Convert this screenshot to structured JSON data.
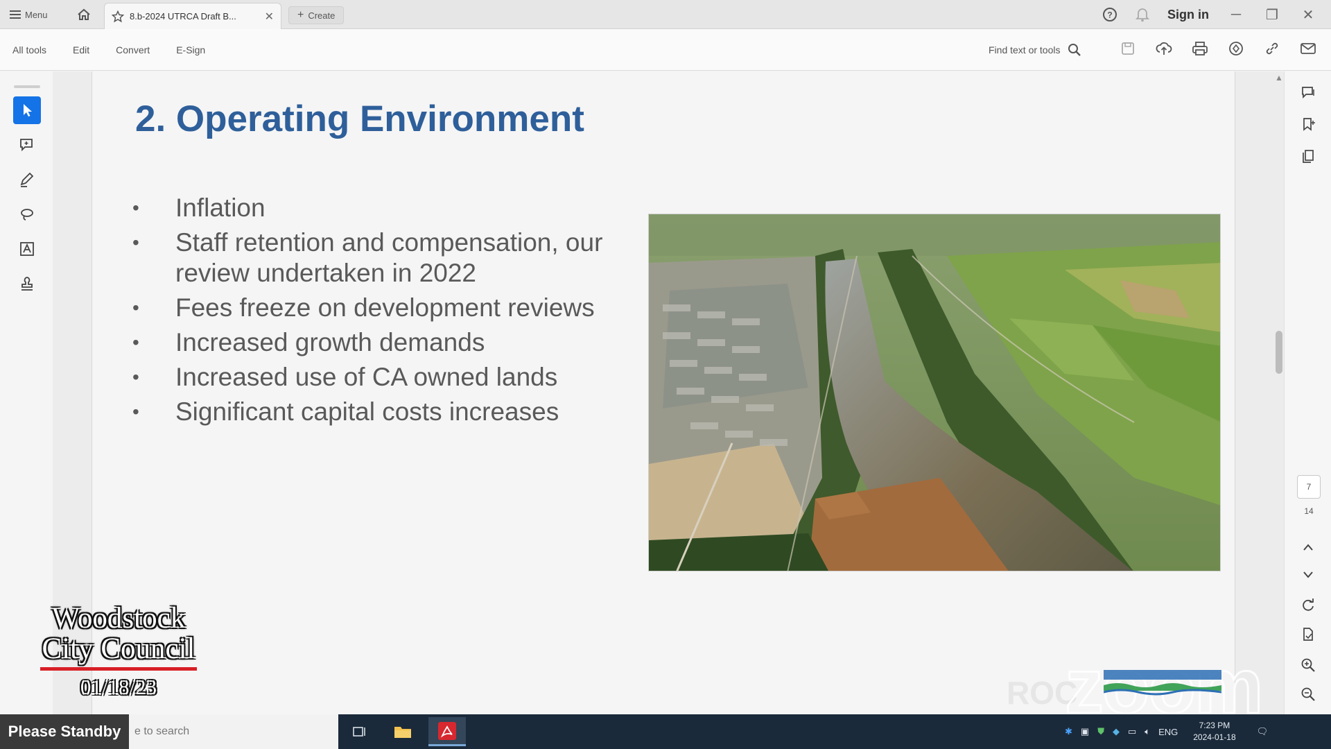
{
  "browser": {
    "menu_label": "Menu",
    "tab_title": "8.b-2024 UTRCA Draft B...",
    "create_label": "Create",
    "sign_in_label": "Sign in"
  },
  "toolbar": {
    "menu_items": [
      "All tools",
      "Edit",
      "Convert",
      "E-Sign"
    ],
    "find_placeholder": "Find text or tools"
  },
  "slide": {
    "title": "2. Operating Environment",
    "bullets": [
      "Inflation",
      "Staff retention and compensation, our review undertaken in 2022",
      "Fees freeze on development reviews",
      "Increased growth demands",
      "Increased use of CA owned lands",
      "Significant capital costs increases"
    ]
  },
  "navigation": {
    "current_page": "7",
    "total_pages": "14"
  },
  "overlay": {
    "council_line1": "Woodstock",
    "council_line2": "City Council",
    "date": "01/18/23",
    "watermark": "zoom",
    "faint_logo_text": "ROC"
  },
  "taskbar": {
    "standby_label": "Please Standby",
    "search_placeholder": "e to search",
    "language": "ENG",
    "time": "7:23 PM",
    "date": "2024-01-18"
  },
  "colors": {
    "accent": "#1473e6",
    "title_blue": "#2e5f9a",
    "overlay_red": "#d81f26",
    "taskbar": "#1b2a3a"
  }
}
